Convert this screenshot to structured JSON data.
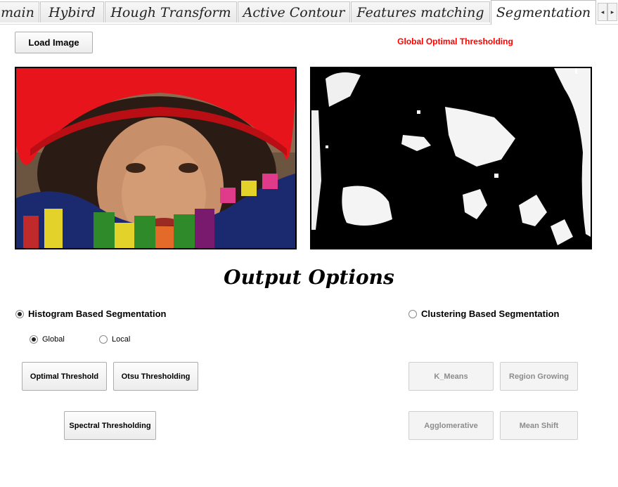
{
  "tabs": [
    {
      "label": "main",
      "active": false
    },
    {
      "label": "Hybird",
      "active": false
    },
    {
      "label": "Hough Transform",
      "active": false
    },
    {
      "label": "Active Contour",
      "active": false
    },
    {
      "label": "Features matching",
      "active": false
    },
    {
      "label": "Segmentation",
      "active": true
    }
  ],
  "tab_scroll": {
    "left": "◂",
    "right": "▸"
  },
  "load_button": "Load Image",
  "status_title": "Global Optimal Thresholding",
  "status_color": "#ff0000",
  "input_image": {
    "description_icon": "image-input"
  },
  "output_image": {
    "description_icon": "image-output"
  },
  "output_heading": "Output Options",
  "histogram_radio": {
    "label": "Histogram Based Segmentation",
    "checked": true
  },
  "clustering_radio": {
    "label": "Clustering Based Segmentation",
    "checked": false
  },
  "global_radio": {
    "label": "Global",
    "checked": true
  },
  "local_radio": {
    "label": "Local",
    "checked": false
  },
  "buttons": {
    "optimal": "Optimal Threshold",
    "otsu": "Otsu Thresholding",
    "spectral": "Spectral Thresholding",
    "kmeans": "K_Means",
    "region_growing": "Region Growing",
    "agglomerative": "Agglomerative",
    "mean_shift": "Mean Shift"
  }
}
